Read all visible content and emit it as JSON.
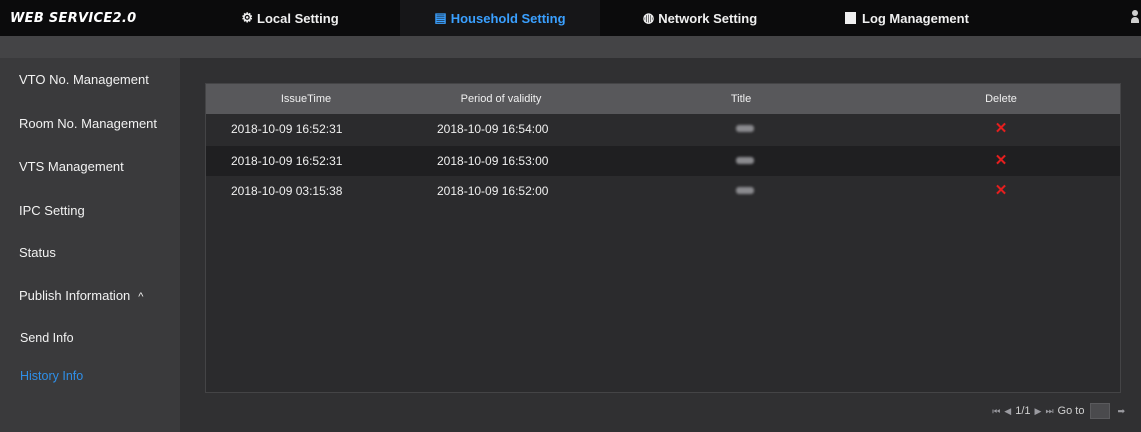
{
  "header": {
    "brand": "WEB SERVICE2.0",
    "nav": [
      {
        "label": "Local Setting",
        "icon": "gear-icon",
        "active": false
      },
      {
        "label": "Household Setting",
        "icon": "household-icon",
        "active": true
      },
      {
        "label": "Network Setting",
        "icon": "globe-icon",
        "active": false
      },
      {
        "label": "Log Management",
        "icon": "log-icon",
        "active": false
      }
    ],
    "accent_color": "#3aa0ff"
  },
  "sidebar": {
    "items": [
      {
        "label": "VTO No. Management"
      },
      {
        "label": "Room No. Management"
      },
      {
        "label": "VTS Management"
      },
      {
        "label": "IPC Setting"
      },
      {
        "label": "Status"
      },
      {
        "label": "Publish Information",
        "expanded": true,
        "caret": "^"
      },
      {
        "label": "Send Info"
      },
      {
        "label": "History Info",
        "active": true
      }
    ]
  },
  "table": {
    "columns": [
      "IssueTime",
      "Period of validity",
      "Title",
      "Delete"
    ],
    "rows": [
      {
        "issue_time": "2018-10-09 16:52:31",
        "validity": "2018-10-09 16:54:00",
        "title": "",
        "delete": "✕"
      },
      {
        "issue_time": "2018-10-09 16:52:31",
        "validity": "2018-10-09 16:53:00",
        "title": "",
        "delete": "✕"
      },
      {
        "issue_time": "2018-10-09 03:15:38",
        "validity": "2018-10-09 16:52:00",
        "title": "",
        "delete": "✕"
      }
    ],
    "delete_color": "#e51e1e"
  },
  "pager": {
    "first": "⏮",
    "prev": "◀",
    "page": "1/1",
    "next": "▶",
    "last": "⏭",
    "goto_label": "Go to",
    "go": "➡"
  }
}
